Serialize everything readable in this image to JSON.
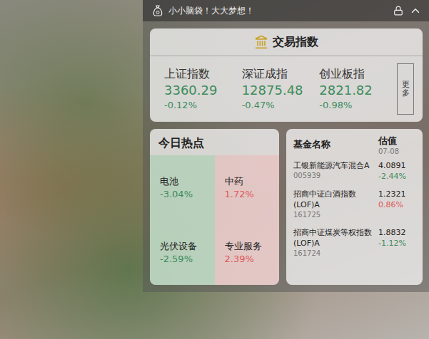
{
  "widget": {
    "title": "小小脑袋！大大梦想！",
    "locked": true
  },
  "indices": {
    "title": "交易指数",
    "more": "更多",
    "items": [
      {
        "name": "上证指数",
        "value": "3360.29",
        "change": "-0.12%",
        "trend": "down"
      },
      {
        "name": "深证成指",
        "value": "12875.48",
        "change": "-0.47%",
        "trend": "down"
      },
      {
        "name": "创业板指",
        "value": "2821.82",
        "change": "-0.98%",
        "trend": "down"
      }
    ]
  },
  "hot": {
    "title": "今日热点",
    "items": [
      {
        "name": "电池",
        "change": "-3.04%",
        "trend": "down"
      },
      {
        "name": "中药",
        "change": "1.72%",
        "trend": "up"
      },
      {
        "name": "光伏设备",
        "change": "-2.59%",
        "trend": "down"
      },
      {
        "name": "专业服务",
        "change": "2.39%",
        "trend": "up"
      }
    ]
  },
  "funds": {
    "columns": [
      "基金名称",
      "估值"
    ],
    "date": "07-08",
    "rows": [
      {
        "name": "工银新能源汽车混合A",
        "code": "005939",
        "value": "4.0891",
        "change": "-2.44%",
        "trend": "down"
      },
      {
        "name": "招商中证白酒指数(LOF)A",
        "code": "161725",
        "value": "1.2321",
        "change": "0.86%",
        "trend": "up"
      },
      {
        "name": "招商中证煤炭等权指数(LOF)A",
        "code": "161724",
        "value": "1.8832",
        "change": "-1.12%",
        "trend": "down"
      }
    ]
  }
}
